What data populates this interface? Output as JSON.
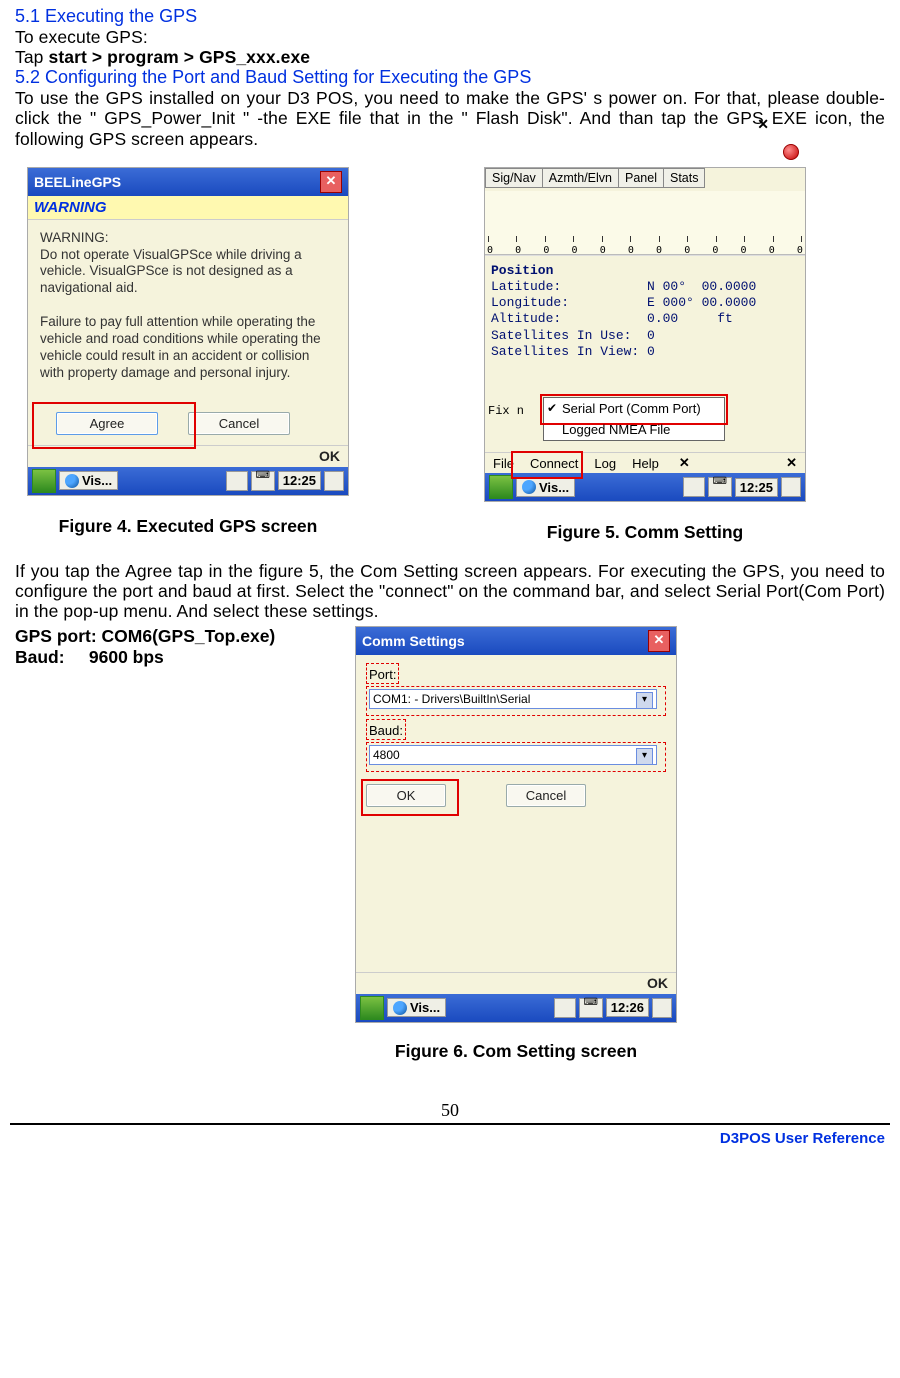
{
  "headings": {
    "h51": "5.1 Executing the GPS",
    "h52": "5.2 Configuring the Port and Baud Setting for Executing the GPS"
  },
  "intro": {
    "toExecute": "To execute GPS:",
    "tapPrefix": "Tap ",
    "tapBold": "start > program > GPS_xxx.exe",
    "para52": "To use the GPS installed on your D3 POS, you need to make the GPS' s power on. For that, please double-click the \" GPS_Power_Init \" -the EXE file that in the \" Flash Disk\". And than tap the GPS EXE icon, the following GPS screen appears."
  },
  "fig4": {
    "title": "BEELineGPS",
    "warningLabel": "WARNING",
    "warnText": "WARNING:\nDo not operate VisualGPSce while driving a vehicle. VisualGPSce is not designed as a navigational aid.\n\nFailure to pay full attention while operating the vehicle and road conditions while operating the vehicle could result in an accident or collision with property damage and personal injury.",
    "agree": "Agree",
    "cancel": "Cancel",
    "ok": "OK",
    "task": "Vis...",
    "time": "12:25",
    "caption": "Figure 4. Executed GPS screen"
  },
  "fig5": {
    "tabs": [
      "Sig/Nav",
      "Azmth/Elvn",
      "Panel",
      "Stats"
    ],
    "zeros": [
      "0",
      "0",
      "0",
      "0",
      "0",
      "0",
      "0",
      "0",
      "0",
      "0",
      "0",
      "0"
    ],
    "posTitle": "Position",
    "posLines": "Latitude:           N 00°  00.0000\nLongitude:          E 000° 00.0000\nAltitude:           0.00     ft\nSatellites In Use:  0\nSatellites In View: 0",
    "serialItem": "Serial Port (Comm Port)",
    "loggedItem": "Logged NMEA File",
    "fixStub": "Fix n",
    "menubar": [
      "File",
      "Connect",
      "Log",
      "Help"
    ],
    "time": "12:25",
    "caption": "Figure 5. Comm Setting"
  },
  "para2": "If you tap the Agree tap in the figure 5, the Com Setting screen appears. For executing the GPS, you need to configure the port and baud at first. Select the \"connect\" on the command bar, and select Serial Port(Com Port) in the pop-up menu. And select these settings.",
  "settings": {
    "portLine": "GPS port: COM6(GPS_Top.exe)",
    "baudLine": "Baud:     9600 bps"
  },
  "fig6": {
    "title": "Comm Settings",
    "portLabel": "Port:",
    "portValue": "COM1: - Drivers\\BuiltIn\\Serial",
    "baudLabel": "Baud:",
    "baudValue": "4800",
    "ok": "OK",
    "cancel": "Cancel",
    "okbar": "OK",
    "task": "Vis...",
    "time": "12:26",
    "caption": "Figure 6. Com Setting screen"
  },
  "pageNum": "50",
  "footer": "D3POS User Reference"
}
